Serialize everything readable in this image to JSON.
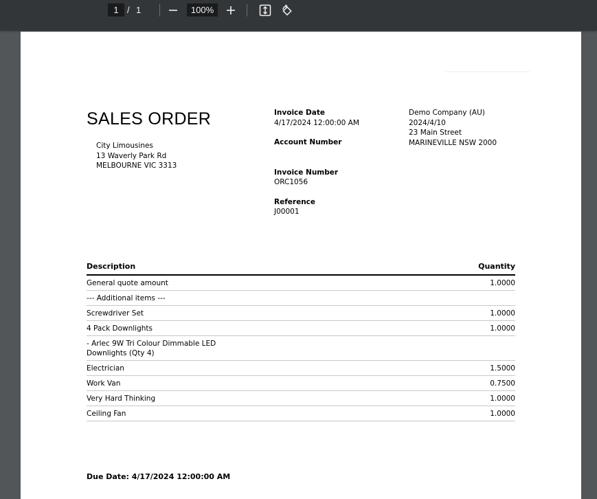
{
  "toolbar": {
    "current_page": "1",
    "page_separator": "/",
    "total_pages": "1",
    "zoom": "100%",
    "icons": [
      "zoom-out-icon",
      "zoom-in-icon",
      "fit-page-icon",
      "rotate-icon"
    ]
  },
  "document": {
    "title": "SALES ORDER",
    "customer": {
      "name": "City Limousines",
      "address1": "13 Waverly Park Rd",
      "address2": "MELBOURNE VIC 3313"
    },
    "invoice_date_label": "Invoice Date",
    "invoice_date": "4/17/2024 12:00:00 AM",
    "account_number_label": "Account Number",
    "invoice_number_label": "Invoice Number",
    "invoice_number": "ORC1056",
    "reference_label": "Reference",
    "reference": "J00001",
    "company": {
      "name": "Demo Company (AU)",
      "date": "2024/4/10",
      "street": "23 Main Street",
      "city": "MARINEVILLE NSW 2000"
    },
    "table": {
      "col_description": "Description",
      "col_quantity": "Quantity",
      "rows": [
        {
          "description": "General quote amount",
          "quantity": "1.0000"
        },
        {
          "description": "--- Additional items ---",
          "quantity": ""
        },
        {
          "description": "Screwdriver Set",
          "quantity": "1.0000"
        },
        {
          "description": "4 Pack Downlights",
          "quantity": "1.0000"
        },
        {
          "description": "- Arlec 9W Tri Colour Dimmable LED Downlights (Qty 4)",
          "quantity": ""
        },
        {
          "description": "Electrician",
          "quantity": "1.5000"
        },
        {
          "description": "Work Van",
          "quantity": "0.7500"
        },
        {
          "description": "Very Hard Thinking",
          "quantity": "1.0000"
        },
        {
          "description": "Ceiling Fan",
          "quantity": "1.0000"
        }
      ]
    },
    "due_date": "Due Date: 4/17/2024 12:00:00 AM"
  }
}
